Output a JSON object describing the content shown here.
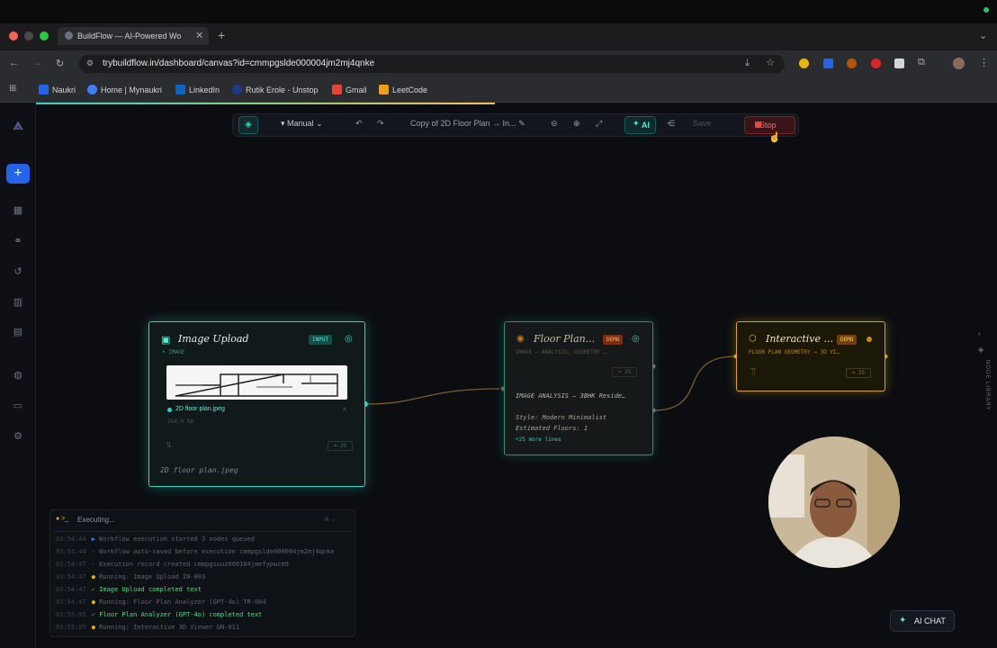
{
  "browser": {
    "tab_title": "BuildFlow — AI-Powered Wo",
    "url": "trybuildflow.in/dashboard/canvas?id=cmmpgslde000004jm2mj4qnke",
    "bookmarks": [
      "Naukri",
      "Home | Mynaukri",
      "LinkedIn",
      "Rutik Erole - Unstop",
      "Gmail",
      "LeetCode"
    ]
  },
  "toolbar": {
    "mode": "Manual",
    "project_name": "Copy of 2D Floor Plan → In...",
    "ai_label": "AI",
    "save_label": "Save",
    "stop_label": "Stop"
  },
  "nodes": {
    "image_upload": {
      "title": "Image Upload",
      "badge": "INPUT",
      "subtitle": "IMAGE",
      "file_name": "2D floor plan.jpeg",
      "file_size": "368.0 KB",
      "zoom": "25",
      "caption": "2D floor plan.jpeg"
    },
    "floor_plan": {
      "title": "Floor Plan...",
      "badge": "DEMO",
      "subtitle": "IMAGE — ANALYSIS, GEOMETRY …",
      "zoom": "25",
      "analysis_heading": "IMAGE ANALYSIS — 3BHK Reside…",
      "style_line": "Style: Modern Minimalist",
      "floors_line": "Estimated Floors: 1",
      "more_lines": "+25 more lines"
    },
    "interactive": {
      "title": "Interactive ...",
      "badge": "DEMO",
      "subtitle": "FLOOR PLAN GEOMETRY → 3D VI…",
      "zoom": "25"
    }
  },
  "log": {
    "header": "Executing...",
    "lines": [
      {
        "time": "03:54:44",
        "text": "Workflow execution started 3 nodes queued"
      },
      {
        "time": "03:54:44",
        "text": "Workflow auto-saved before execution cmmpgslde000004jm2mj4qnke"
      },
      {
        "time": "03:54:47",
        "text": "Execution record created cmmpgsouz000104jmefypwcm9"
      },
      {
        "time": "03:54:47",
        "text": "Running: Image Upload IN-003"
      },
      {
        "time": "03:54:47",
        "text": "Image Upload completed text"
      },
      {
        "time": "03:54:47",
        "text": "Running: Floor Plan Analyzer (GPT-4o) TR-004"
      },
      {
        "time": "03:55:05",
        "text": "Floor Plan Analyzer (GPT-4o) completed text"
      },
      {
        "time": "03:55:05",
        "text": "Running: Interactive 3D Viewer GN-011"
      }
    ]
  },
  "ai_chat_label": "AI CHAT",
  "node_library_label": "NODE LIBRARY",
  "colors": {
    "accent": "#2dd4bf",
    "warning": "#eab308",
    "stop": "#ef4444",
    "primary": "#2563eb"
  }
}
